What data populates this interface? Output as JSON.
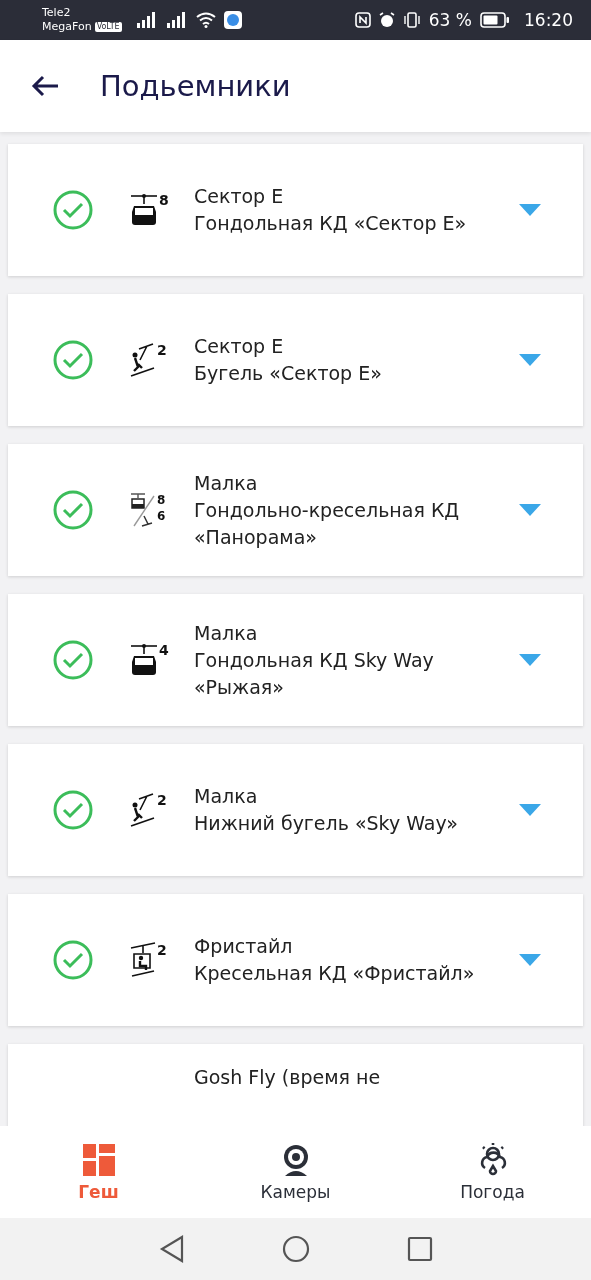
{
  "status_bar": {
    "carrier_1": "Tele2",
    "carrier_2": "MegaFon",
    "volte": "VoLTE",
    "battery": "63 %",
    "time": "16:20"
  },
  "header": {
    "title": "Подьемники"
  },
  "lifts": [
    {
      "open": true,
      "kind": "gondola",
      "capacity": [
        "8"
      ],
      "area": "Сектор Е",
      "name": "Гондольная КД «Сектор Е»"
    },
    {
      "open": true,
      "kind": "tbar",
      "capacity": [
        "2"
      ],
      "area": "Сектор Е",
      "name": "Бугель «Сектор Е»"
    },
    {
      "open": true,
      "kind": "combo",
      "capacity": [
        "8",
        "6"
      ],
      "area": "Малка",
      "name": "Гондольно-кресельная КД «Панорама»"
    },
    {
      "open": true,
      "kind": "gondola",
      "capacity": [
        "4"
      ],
      "area": "Малка",
      "name": "Гондольная КД Sky Way «Рыжая»"
    },
    {
      "open": true,
      "kind": "tbar",
      "capacity": [
        "2"
      ],
      "area": "Малка",
      "name": "Нижний бугель «Sky Way»"
    },
    {
      "open": true,
      "kind": "chair",
      "capacity": [
        "2"
      ],
      "area": "Фристайл",
      "name": "Кресельная КД «Фристайл»"
    }
  ],
  "partial_lift": {
    "area": "Gosh Fly (время не"
  },
  "bottom_nav": [
    {
      "kind": "grid",
      "label": "Геш",
      "selected": true
    },
    {
      "kind": "camera",
      "label": "Камеры",
      "selected": false
    },
    {
      "kind": "weather",
      "label": "Погода",
      "selected": false
    }
  ]
}
